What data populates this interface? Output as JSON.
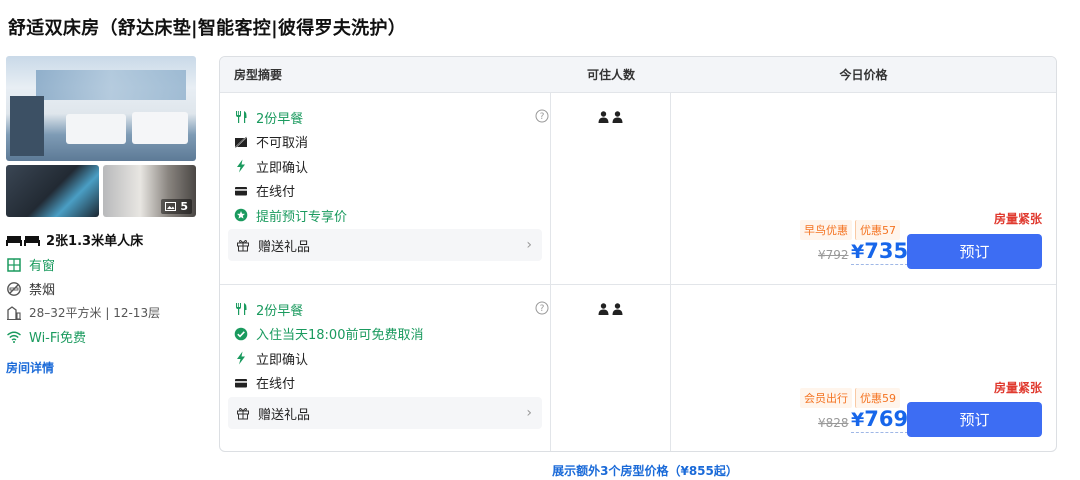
{
  "room": {
    "title": "舒适双床房（舒达床垫|智能客控|彼得罗夫洗护）",
    "photo_count": "5",
    "bed": "2张1.3米单人床",
    "features": [
      {
        "icon": "window-icon",
        "text": "有窗",
        "style": "green"
      },
      {
        "icon": "no-smoking-icon",
        "text": "禁烟",
        "style": "normal"
      },
      {
        "icon": "floor-area-icon",
        "text": "28–32平方米 | 12-13层",
        "style": "grey"
      },
      {
        "icon": "wifi-icon",
        "text": "Wi-Fi免费",
        "style": "green"
      }
    ],
    "details_link": "房间详情"
  },
  "table": {
    "headers": {
      "summary": "房型摘要",
      "occupancy": "可住人数",
      "price": "今日价格"
    },
    "rows": [
      {
        "perks": [
          {
            "icon": "fork-knife-icon",
            "text": "2份早餐",
            "style": "green"
          },
          {
            "icon": "no-cancel-icon",
            "text": "不可取消",
            "style": "normal"
          },
          {
            "icon": "lightning-icon",
            "text": "立即确认",
            "style": "normal"
          },
          {
            "icon": "card-icon",
            "text": "在线付",
            "style": "normal"
          },
          {
            "icon": "star-badge-icon",
            "text": "提前预订专享价",
            "style": "green"
          }
        ],
        "gift": "赠送礼品",
        "occupancy_icon": "two-person-icon",
        "scarcity": "房量紧张",
        "promo_tags": [
          "早鸟优惠",
          "优惠57"
        ],
        "original_price": "¥792",
        "price_symbol": "¥",
        "price": "735",
        "book_label": "预订"
      },
      {
        "perks": [
          {
            "icon": "fork-knife-icon",
            "text": "2份早餐",
            "style": "green"
          },
          {
            "icon": "check-circle-icon",
            "text": "入住当天18:00前可免费取消",
            "style": "green"
          },
          {
            "icon": "lightning-icon",
            "text": "立即确认",
            "style": "normal"
          },
          {
            "icon": "card-icon",
            "text": "在线付",
            "style": "normal"
          }
        ],
        "gift": "赠送礼品",
        "occupancy_icon": "two-person-icon",
        "scarcity": "房量紧张",
        "promo_tags": [
          "会员出行",
          "优惠59"
        ],
        "original_price": "¥828",
        "price_symbol": "¥",
        "price": "769",
        "book_label": "预订"
      }
    ]
  },
  "more_link": "展示额外3个房型价格（¥855起）",
  "colors": {
    "accent_blue": "#1766ea",
    "button_blue": "#3d6df3",
    "green": "#1a9a5e",
    "scarce_red": "#e03a2f",
    "promo_orange": "#f47321"
  }
}
